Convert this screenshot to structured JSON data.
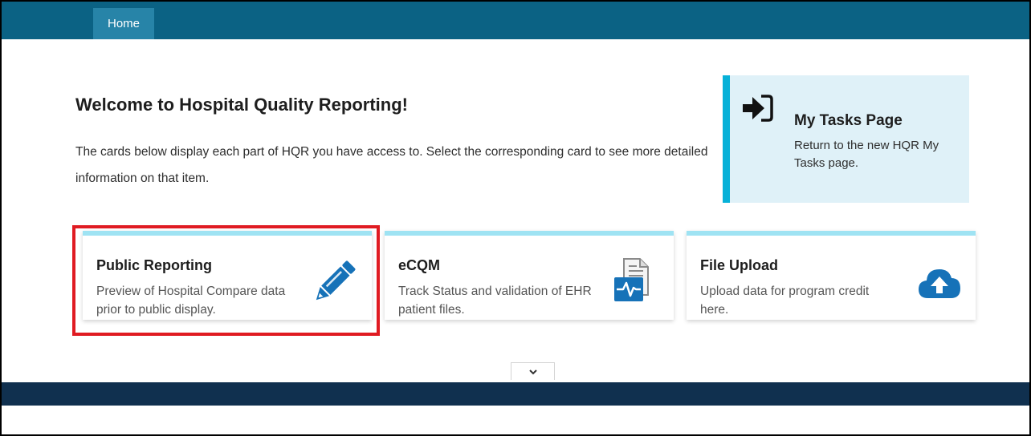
{
  "nav": {
    "home_label": "Home"
  },
  "welcome": {
    "title": "Welcome to Hospital Quality Reporting!",
    "description": "The cards below display each part of HQR you have access to. Select the corresponding card to see more detailed information on that item."
  },
  "tasks_card": {
    "title": "My Tasks Page",
    "description": "Return to the new HQR My Tasks page.",
    "icon": "sign-in-icon"
  },
  "cards": [
    {
      "title": "Public Reporting",
      "description": "Preview of Hospital Compare data prior to public display.",
      "icon": "pencil-icon"
    },
    {
      "title": "eCQM",
      "description": "Track Status and validation of EHR patient files.",
      "icon": "ehr-file-icon"
    },
    {
      "title": "File Upload",
      "description": "Upload data for program credit here.",
      "icon": "cloud-upload-icon"
    }
  ],
  "colors": {
    "nav_bg": "#0b6284",
    "active_tab": "#2784a8",
    "card_accent": "#9fe3f3",
    "tasks_bg": "#dff1f8",
    "tasks_accent": "#07b1d8",
    "icon_blue": "#1672b8",
    "highlight": "#e01b22",
    "footer": "#10304f"
  }
}
